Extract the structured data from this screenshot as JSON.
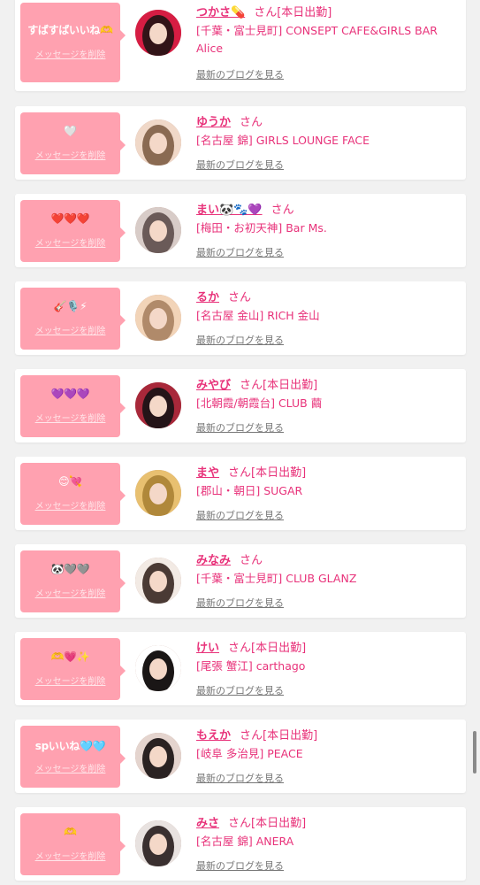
{
  "delete_label": "メッセージを削除",
  "san_label": "さん",
  "blog_label": "最新のブログを見る",
  "entries": [
    {
      "message": "すばすばいいね🫶",
      "name": "つかさ💊",
      "badge": "[本日出勤]",
      "shop": "[千葉・富士見町] CONSEPT CAFE&GIRLS BAR Alice",
      "avatar_colors": [
        "#d61d43",
        "#321418"
      ]
    },
    {
      "message": "🤍",
      "name": "ゆうか",
      "badge": "",
      "shop": "[名古屋 錦] GIRLS LOUNGE FACE",
      "avatar_colors": [
        "#f0d8c8",
        "#8a6a52"
      ]
    },
    {
      "message": "❤️❤️❤️",
      "name": "まい🐼🐾💜",
      "badge": "",
      "shop": "[梅田・お初天神] Bar Ms.",
      "avatar_colors": [
        "#d8ccc8",
        "#6a5a58"
      ]
    },
    {
      "message": "🎸🎙️⚡",
      "name": "るか",
      "badge": "",
      "shop": "[名古屋 金山] RICH 金山",
      "avatar_colors": [
        "#f2d4b8",
        "#b08a6a"
      ]
    },
    {
      "message": "💜💜💜",
      "name": "みやび",
      "badge": "[本日出勤]",
      "shop": "[北朝霞/朝霞台] CLUB 繭",
      "avatar_colors": [
        "#a8283a",
        "#241418"
      ]
    },
    {
      "message": "😊💘",
      "name": "まや",
      "badge": "[本日出勤]",
      "shop": "[郡山・朝日] SUGAR",
      "avatar_colors": [
        "#e8c070",
        "#b0883a"
      ]
    },
    {
      "message": "🐼🩶🩶",
      "name": "みなみ",
      "badge": "",
      "shop": "[千葉・富士見町] CLUB GLANZ",
      "avatar_colors": [
        "#f2eae4",
        "#4a3a34"
      ]
    },
    {
      "message": "🫶💗✨",
      "name": "けい",
      "badge": "[本日出勤]",
      "shop": "[尾張 蟹江] carthago",
      "avatar_colors": [
        "#ffffff",
        "#1a1616"
      ]
    },
    {
      "message": "spいいね🩵🩵",
      "name": "もえか",
      "badge": "[本日出勤]",
      "shop": "[岐阜 多治見] PEACE",
      "avatar_colors": [
        "#e4d4ce",
        "#2a2222"
      ]
    },
    {
      "message": "🫶",
      "name": "みさ",
      "badge": "[本日出勤]",
      "shop": "[名古屋 錦] ANERA",
      "avatar_colors": [
        "#e8e2e0",
        "#3a3030"
      ]
    }
  ]
}
